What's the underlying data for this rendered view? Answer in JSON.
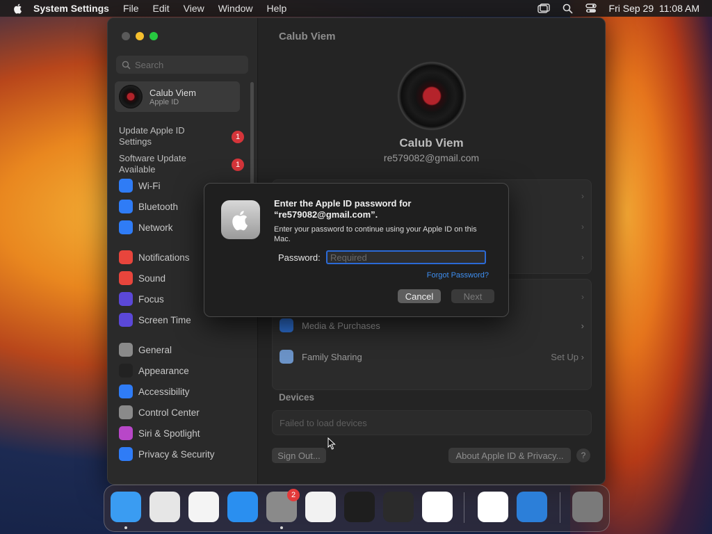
{
  "menubar": {
    "app_name": "System Settings",
    "menus": [
      "File",
      "Edit",
      "View",
      "Window",
      "Help"
    ],
    "clock": "Fri Sep 29  11:08 AM",
    "status_icons": [
      "screen-mirroring-icon",
      "spotlight-search-icon",
      "control-center-icon"
    ]
  },
  "window": {
    "title": "Calub Viem",
    "sidebar": {
      "search_placeholder": "Search",
      "account": {
        "name": "Calub Viem",
        "subtitle": "Apple ID"
      },
      "notices": [
        {
          "label": "Update Apple ID Settings",
          "count": "1"
        },
        {
          "label": "Software Update Available",
          "count": "1"
        }
      ],
      "items": [
        {
          "label": "Wi-Fi",
          "icon": "wifi-icon",
          "color": "#2f7cf6"
        },
        {
          "label": "Bluetooth",
          "icon": "bluetooth-icon",
          "color": "#2f7cf6"
        },
        {
          "label": "Network",
          "icon": "network-icon",
          "color": "#2f7cf6"
        },
        {
          "label": "Notifications",
          "icon": "bell-icon",
          "color": "#e8453c"
        },
        {
          "label": "Sound",
          "icon": "speaker-icon",
          "color": "#e8453c"
        },
        {
          "label": "Focus",
          "icon": "moon-icon",
          "color": "#5b48d8"
        },
        {
          "label": "Screen Time",
          "icon": "hourglass-icon",
          "color": "#5b48d8"
        },
        {
          "label": "General",
          "icon": "gear-icon",
          "color": "#8a8a8a"
        },
        {
          "label": "Appearance",
          "icon": "appearance-icon",
          "color": "#222222"
        },
        {
          "label": "Accessibility",
          "icon": "accessibility-icon",
          "color": "#2f7cf6"
        },
        {
          "label": "Control Center",
          "icon": "control-center-icon",
          "color": "#8a8a8a"
        },
        {
          "label": "Siri & Spotlight",
          "icon": "siri-icon",
          "color": "#b847c8"
        },
        {
          "label": "Privacy & Security",
          "icon": "hand-icon",
          "color": "#2f7cf6"
        }
      ]
    },
    "profile": {
      "name": "Calub Viem",
      "email": "re579082@gmail.com"
    },
    "rows": {
      "media": "Media & Purchases",
      "family": "Family Sharing",
      "family_action": "Set Up"
    },
    "devices": {
      "header": "Devices",
      "status": "Failed to load devices"
    },
    "footer": {
      "sign_out": "Sign Out...",
      "about": "About Apple ID & Privacy...",
      "help": "?"
    }
  },
  "dialog": {
    "title": "Enter the Apple ID password for “re579082@gmail.com”.",
    "message": "Enter your password to continue using your Apple ID on this Mac.",
    "password_label": "Password:",
    "password_placeholder": "Required",
    "forgot": "Forgot Password?",
    "cancel": "Cancel",
    "next": "Next"
  },
  "dock": {
    "apps": [
      {
        "name": "Finder",
        "icon": "finder-icon",
        "color": "#3a9cf2",
        "running": true
      },
      {
        "name": "Launchpad",
        "icon": "launchpad-icon",
        "color": "#e6e6e6",
        "running": false
      },
      {
        "name": "Safari",
        "icon": "safari-icon",
        "color": "#f4f4f4",
        "running": false
      },
      {
        "name": "App Store",
        "icon": "app-store-icon",
        "color": "#2a8ff0",
        "running": false
      },
      {
        "name": "System Settings",
        "icon": "system-settings-icon",
        "color": "#8a8a8a",
        "running": true,
        "badge": "2"
      },
      {
        "name": "TextEdit",
        "icon": "textedit-icon",
        "color": "#f2f2f2",
        "running": false
      },
      {
        "name": "Terminal",
        "icon": "terminal-icon",
        "color": "#1e1e1e",
        "running": false
      },
      {
        "name": "GarageBand",
        "icon": "garageband-icon",
        "color": "#2b2b2b",
        "running": false
      },
      {
        "name": "Visual Studio Code",
        "icon": "vscode-icon",
        "color": "#ffffff",
        "running": false
      },
      {
        "name": "Visual Studio",
        "icon": "visual-studio-icon",
        "color": "#ffffff",
        "running": false
      },
      {
        "name": "Weather",
        "icon": "weather-icon",
        "color": "#2c7fd9",
        "running": false
      },
      {
        "name": "Trash",
        "icon": "trash-icon",
        "color": "#7a7a7a",
        "running": false
      }
    ]
  }
}
